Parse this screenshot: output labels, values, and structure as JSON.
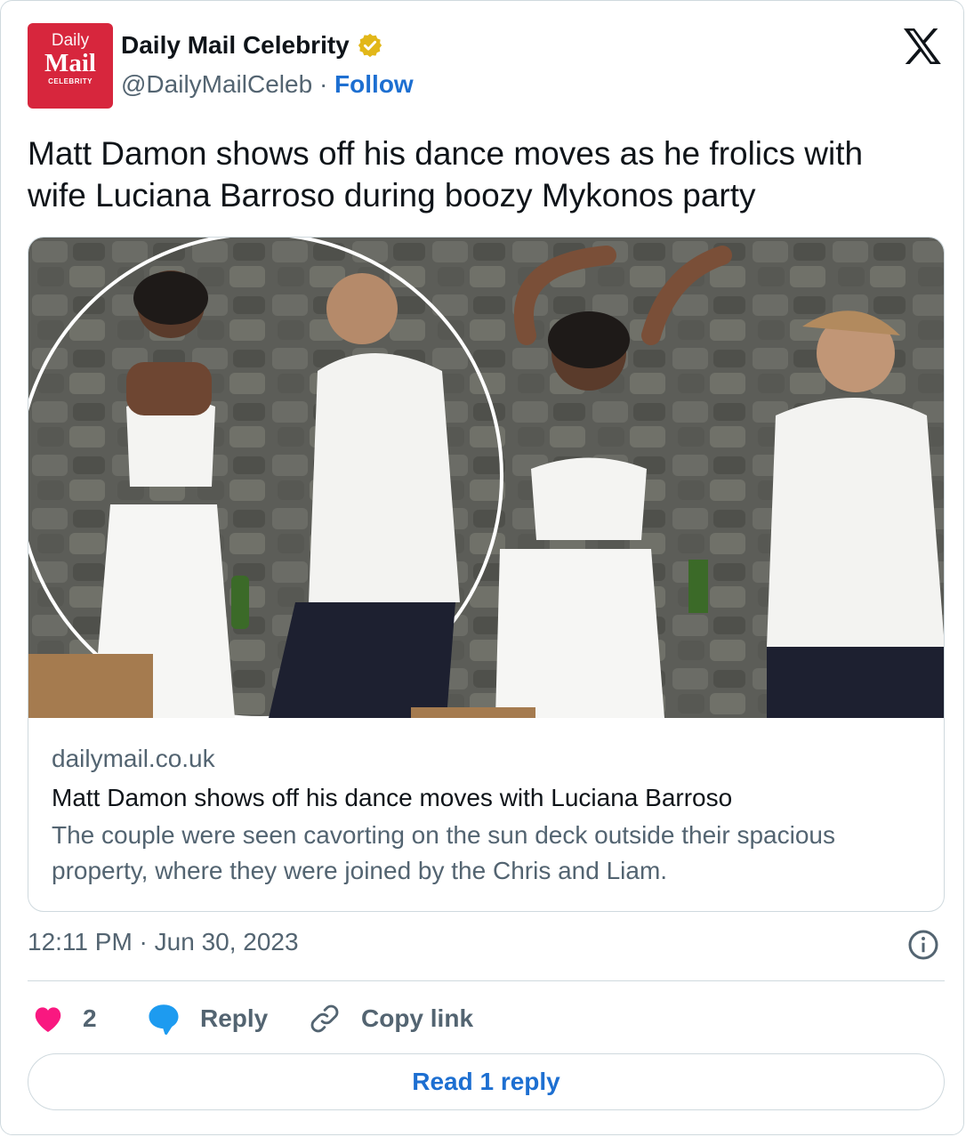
{
  "author": {
    "avatar": {
      "line1": "Daily",
      "line2": "Mail",
      "line3": "CELEBRITY"
    },
    "name": "Daily Mail Celebrity",
    "handle": "@DailyMailCeleb",
    "separator": "·",
    "follow_label": "Follow"
  },
  "tweet": {
    "text_line1": "Matt Damon shows off his dance moves as he frolics with",
    "text_line2": "wife Luciana Barroso during boozy Mykonos party"
  },
  "link_card": {
    "domain": "dailymail.co.uk",
    "title": "Matt Damon shows off his dance moves with Luciana Barroso",
    "description": "The couple were seen cavorting on the sun deck outside their spacious property, where they were joined by the Chris and Liam."
  },
  "timestamp": "12:11 PM · Jun 30, 2023",
  "actions": {
    "like_count": "2",
    "reply_label": "Reply",
    "copy_link_label": "Copy link"
  },
  "read_replies_label": "Read 1 reply",
  "colors": {
    "brand_red": "#d7263d",
    "link_blue": "#1d6fd1",
    "heart_pink": "#f91880",
    "reply_blue": "#1d9bf0",
    "muted_text": "#536471",
    "border": "#cfd9de"
  },
  "icons": [
    "verified-badge-icon",
    "x-logo-icon",
    "info-icon",
    "heart-icon",
    "reply-bubble-icon",
    "link-icon"
  ]
}
